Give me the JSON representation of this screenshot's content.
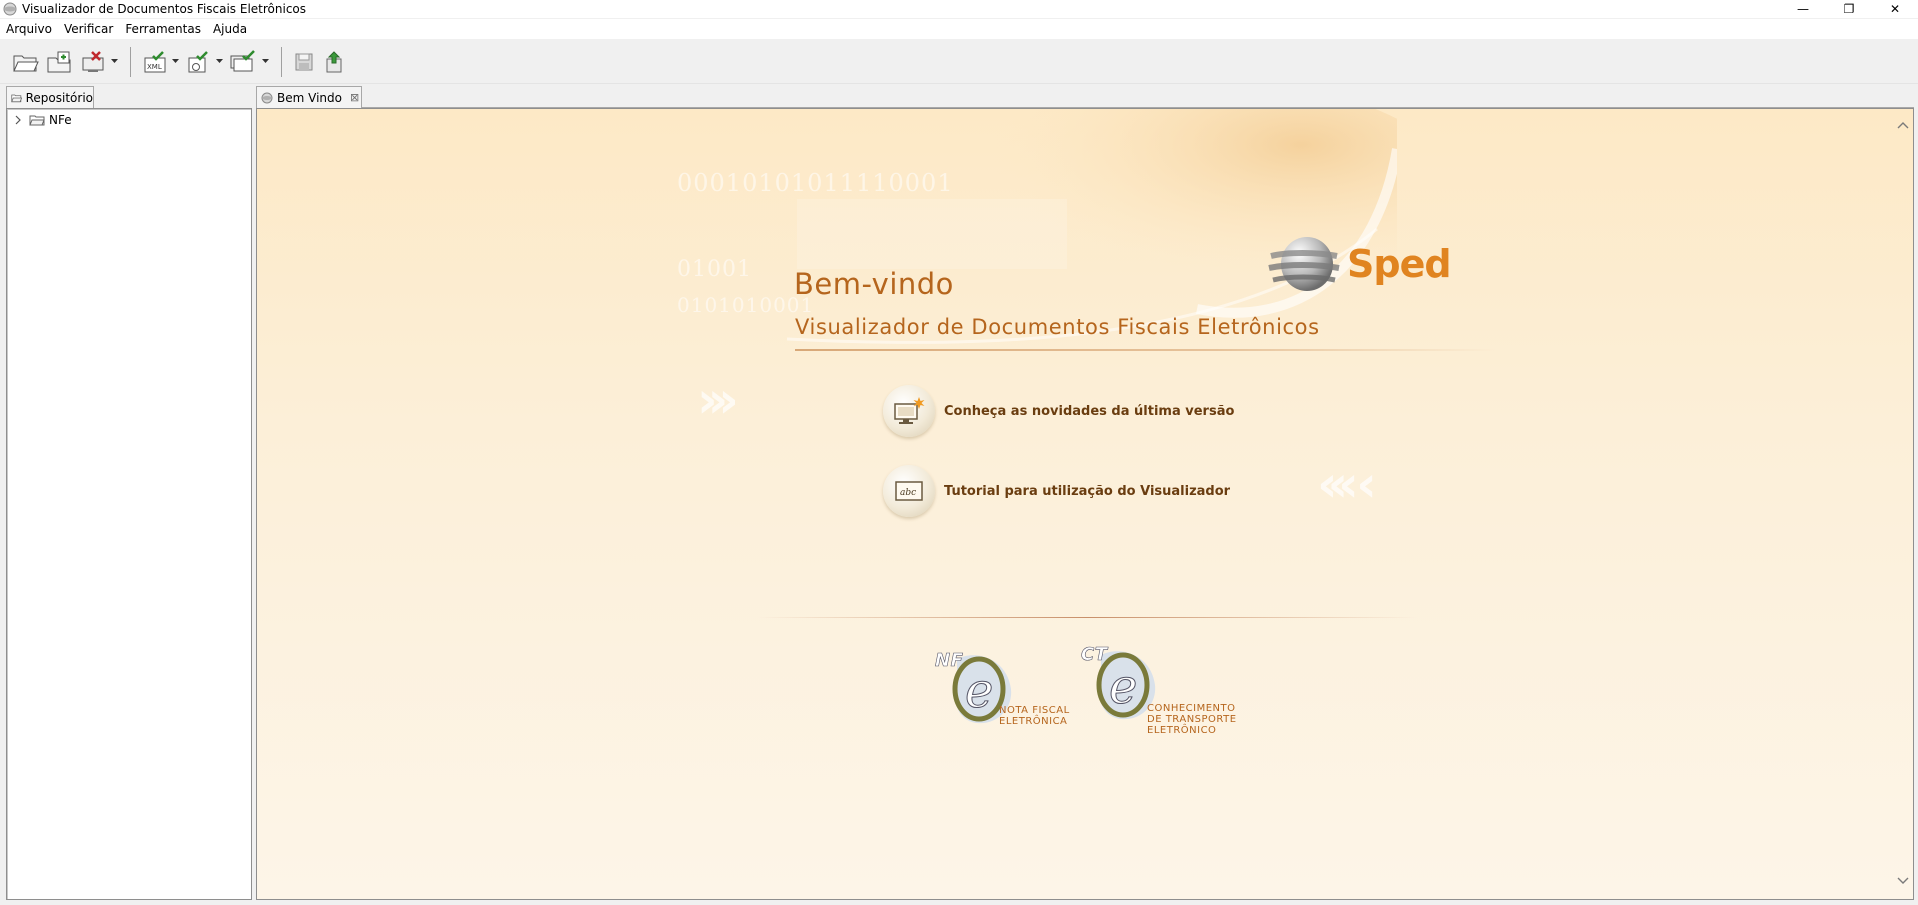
{
  "window": {
    "title": "Visualizador de Documentos Fiscais Eletrônicos",
    "minimize": "—",
    "restore": "❐",
    "close": "✕"
  },
  "menu": [
    "Arquivo",
    "Verificar",
    "Ferramentas",
    "Ajuda"
  ],
  "left_panel": {
    "tab_label": "Repositório",
    "tree": [
      {
        "label": "NFe",
        "expanded": false
      }
    ]
  },
  "editor": {
    "tab_label": "Bem Vindo",
    "tab_close": "⊠"
  },
  "welcome": {
    "binary_line_1": "00010101011110001",
    "binary_line_2": "01001",
    "binary_line_3": "0101010001",
    "brand": "Sped",
    "heading": "Bem-vindo",
    "subtitle": "Visualizador de Documentos Fiscais Eletrônicos",
    "links": [
      {
        "label": "Conheça as novidades da última versão",
        "icon": "monitor-news-icon"
      },
      {
        "label": "Tutorial para utilização do Visualizador",
        "icon": "abc-tutorial-icon"
      }
    ],
    "logos": [
      {
        "mark": "NF",
        "caption_lines": [
          "NOTA FISCAL",
          "ELETRÔNICA"
        ]
      },
      {
        "mark": "CT",
        "caption_lines": [
          "CONHECIMENTO",
          "DE TRANSPORTE",
          "ELETRÔNICO"
        ]
      }
    ]
  },
  "colors": {
    "accent": "#b5651d",
    "brand_orange": "#e08420",
    "link_text": "#6a3d10"
  }
}
